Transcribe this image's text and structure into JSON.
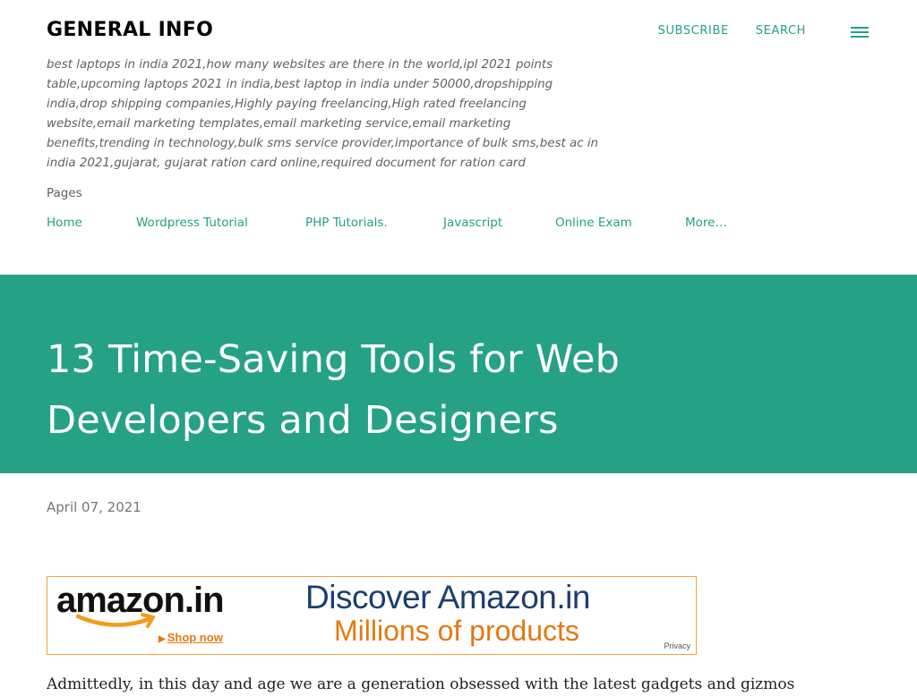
{
  "header": {
    "blog_title": "GENERAL INFO",
    "subscribe_label": "SUBSCRIBE",
    "search_label": "SEARCH",
    "menu_icon": "hamburger-menu-icon",
    "description": "best laptops in india 2021,how many websites are there in the world,ipl 2021 points table,upcoming laptops 2021 in india,best laptop in india under 50000,dropshipping india,drop shipping companies,Highly paying freelancing,High rated freelancing website,email marketing templates,email marketing service,email marketing benefits,trending in technology,bulk sms service provider,importance of bulk sms,best ac in india 2021,gujarat, gujarat ration card online,required document for ration card"
  },
  "pages": {
    "label": "Pages",
    "items": [
      {
        "label": "Home"
      },
      {
        "label": "Wordpress Tutorial"
      },
      {
        "label": "PHP Tutorials."
      },
      {
        "label": "Javascript"
      },
      {
        "label": "Online Exam"
      },
      {
        "label": "More…"
      }
    ]
  },
  "post": {
    "title": "13 Time-Saving Tools for Web Developers and Designers",
    "date": "April 07, 2021",
    "body_first_line": "Admittedly, in this day and age we are a generation obsessed with the latest gadgets and gizmos"
  },
  "ad": {
    "logo_text": "amazon.in",
    "shop_now": "Shop now",
    "headline": "Discover Amazon.in",
    "subheadline": "Millions of products",
    "privacy": "Privacy"
  },
  "colors": {
    "accent": "#24a086",
    "title_band": "#25a286",
    "amazon_orange": "#e47911",
    "amazon_navy": "#1c3e6e"
  }
}
